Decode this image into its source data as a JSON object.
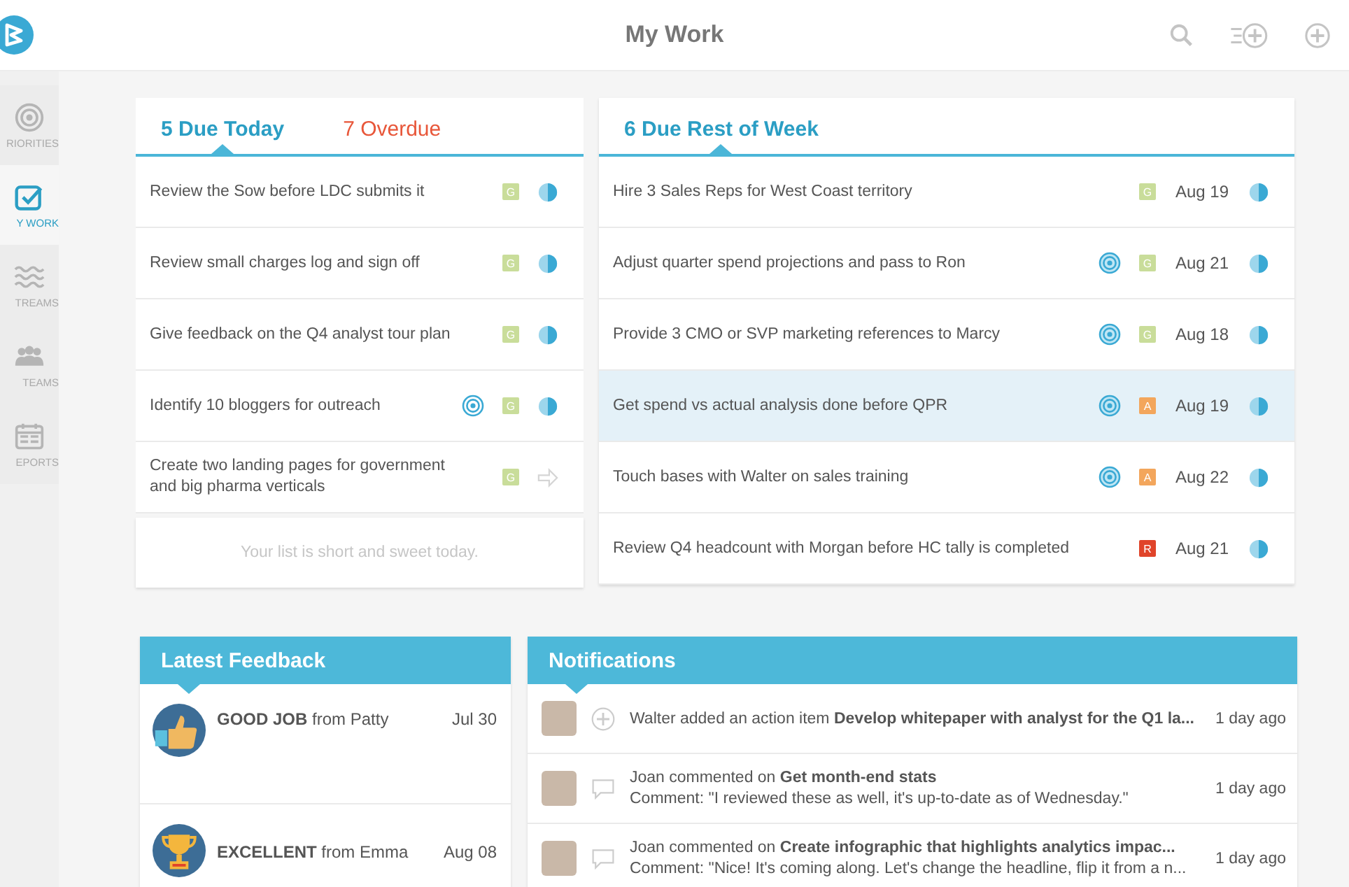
{
  "header": {
    "title": "My Work"
  },
  "sidebar": {
    "items": [
      {
        "label": "RIORITIES",
        "kind": "target",
        "selected": false
      },
      {
        "label": "Y WORK",
        "kind": "check",
        "selected": true
      },
      {
        "label": "TREAMS",
        "kind": "waves",
        "selected": false
      },
      {
        "label": "TEAMS",
        "kind": "people",
        "selected": false
      },
      {
        "label": "EPORTS",
        "kind": "calendar",
        "selected": false
      }
    ]
  },
  "today_card": {
    "tabs": [
      {
        "label": "5 Due Today",
        "selected": true,
        "color": "#2b9ec4"
      },
      {
        "label": "7 Overdue",
        "selected": false,
        "color": "#e8573a"
      }
    ],
    "tasks": [
      {
        "text": "Review the Sow before LDC submits it",
        "target": false,
        "tag": "G",
        "color": "#c9dd9a",
        "kind": "half"
      },
      {
        "text": "Review small charges log and sign off",
        "target": false,
        "tag": "G",
        "color": "#c9dd9a",
        "kind": "half"
      },
      {
        "text": "Give feedback on the Q4 analyst tour plan",
        "target": false,
        "tag": "G",
        "color": "#c9dd9a",
        "kind": "half"
      },
      {
        "text": "Identify 10 bloggers for outreach",
        "target": true,
        "tag": "G",
        "color": "#c9dd9a",
        "kind": "half"
      },
      {
        "text": "Create two landing pages for government and big pharma verticals",
        "target": false,
        "tag": "G",
        "color": "#c9dd9a",
        "kind": "arrow"
      }
    ],
    "empty_note": "Your list is short and sweet today."
  },
  "week_card": {
    "tabs": [
      {
        "label": "6 Due Rest of Week",
        "selected": true,
        "color": "#2b9ec4"
      }
    ],
    "tasks": [
      {
        "text": "Hire 3 Sales Reps for West Coast territory",
        "target": false,
        "tag": "G",
        "color": "#c9dd9a",
        "date": "Aug 19",
        "kind": "half",
        "selected": false
      },
      {
        "text": "Adjust quarter spend projections and pass to Ron",
        "target": true,
        "tag": "G",
        "color": "#c9dd9a",
        "date": "Aug 21",
        "kind": "half",
        "selected": false
      },
      {
        "text": "Provide 3 CMO or SVP marketing references to Marcy",
        "target": true,
        "tag": "G",
        "color": "#c9dd9a",
        "date": "Aug 18",
        "kind": "half",
        "selected": false
      },
      {
        "text": "Get spend vs actual analysis done before QPR",
        "target": true,
        "tag": "A",
        "color": "#f3a65c",
        "date": "Aug 19",
        "kind": "half",
        "selected": true
      },
      {
        "text": "Touch bases with Walter on sales training",
        "target": true,
        "tag": "A",
        "color": "#f3a65c",
        "date": "Aug 22",
        "kind": "half",
        "selected": false
      },
      {
        "text": "Review Q4 headcount with Morgan before HC tally is completed",
        "target": false,
        "tag": "R",
        "color": "#e0442a",
        "date": "Aug 21",
        "kind": "half",
        "selected": false
      }
    ]
  },
  "feedback": {
    "title": "Latest Feedback",
    "items": [
      {
        "kind": "thumbs",
        "text": "**GOOD JOB** from Patty",
        "date": "Jul 30"
      },
      {
        "kind": "trophy",
        "text": "**EXCELLENT** from Emma",
        "date": "Aug 08"
      }
    ]
  },
  "notifications": {
    "title": "Notifications",
    "items": [
      {
        "kind": "plus",
        "text": "Walter added an action item **Develop whitepaper with analyst for the Q1 la...**",
        "time": "1 day ago"
      },
      {
        "kind": "comment",
        "text": "Joan commented on **Get month-end stats**",
        "comment": "Comment: \"I reviewed these as well, it's up-to-date as of Wednesday.\"",
        "time": "1 day ago"
      },
      {
        "kind": "comment",
        "text": "Joan commented on **Create infographic that highlights analytics impac...**",
        "comment": "Comment: \"Nice! It's coming along. Let's change the headline, flip it from a n...",
        "time": "1 day ago"
      }
    ]
  }
}
